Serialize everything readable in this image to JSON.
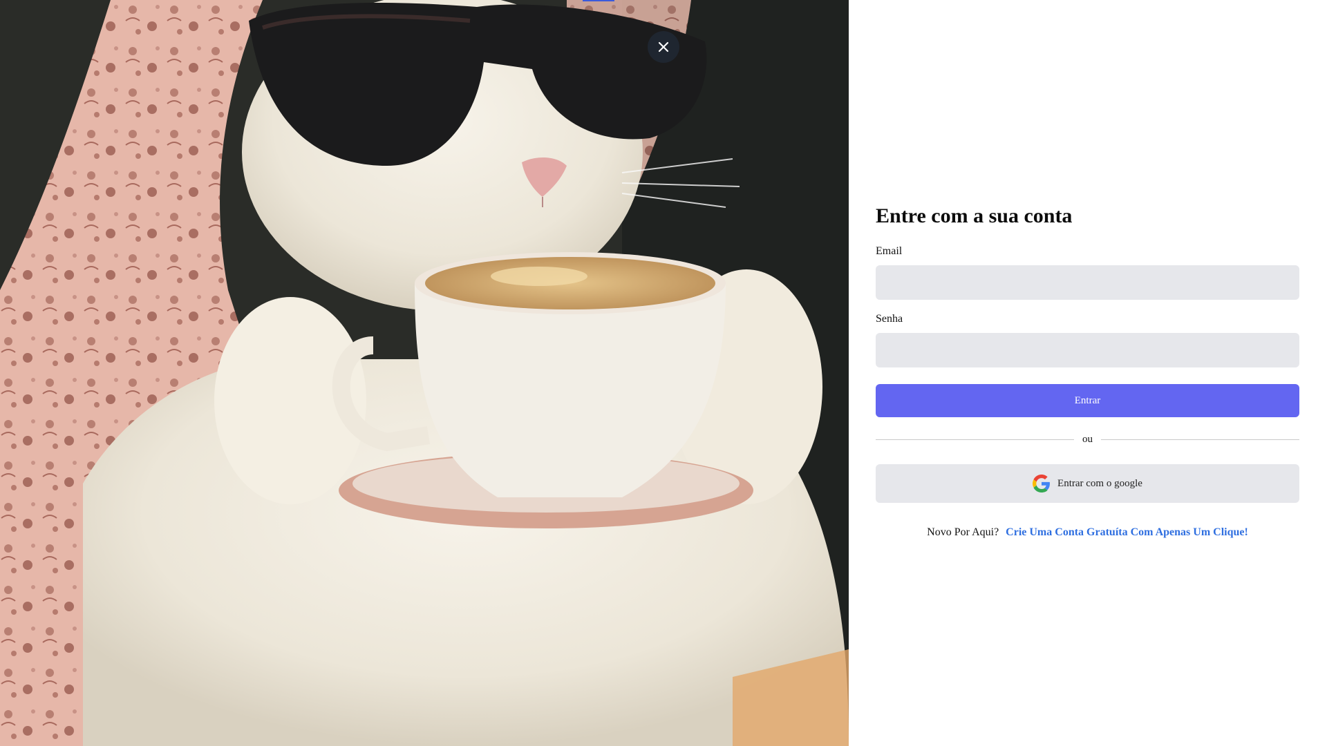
{
  "photo": {
    "subject_icon": "cat-with-sunglasses-and-teacup-photo"
  },
  "close": {
    "icon": "close-icon",
    "label": "×"
  },
  "form": {
    "title": "Entre com a sua conta",
    "email_label": "Email",
    "email_value": "",
    "password_label": "Senha",
    "password_value": "",
    "submit_label": "Entrar",
    "divider_text": "ou",
    "google_label": "Entrar com o google",
    "google_icon": "google-icon",
    "signup_prompt": "Novo Por Aqui?",
    "signup_link": "Crie Uma Conta Gratuíta Com Apenas Um Clique!"
  },
  "colors": {
    "primary": "#6366f1",
    "input_bg": "#e6e7eb",
    "link": "#2f6fe0",
    "close_bg": "#1f2630"
  }
}
